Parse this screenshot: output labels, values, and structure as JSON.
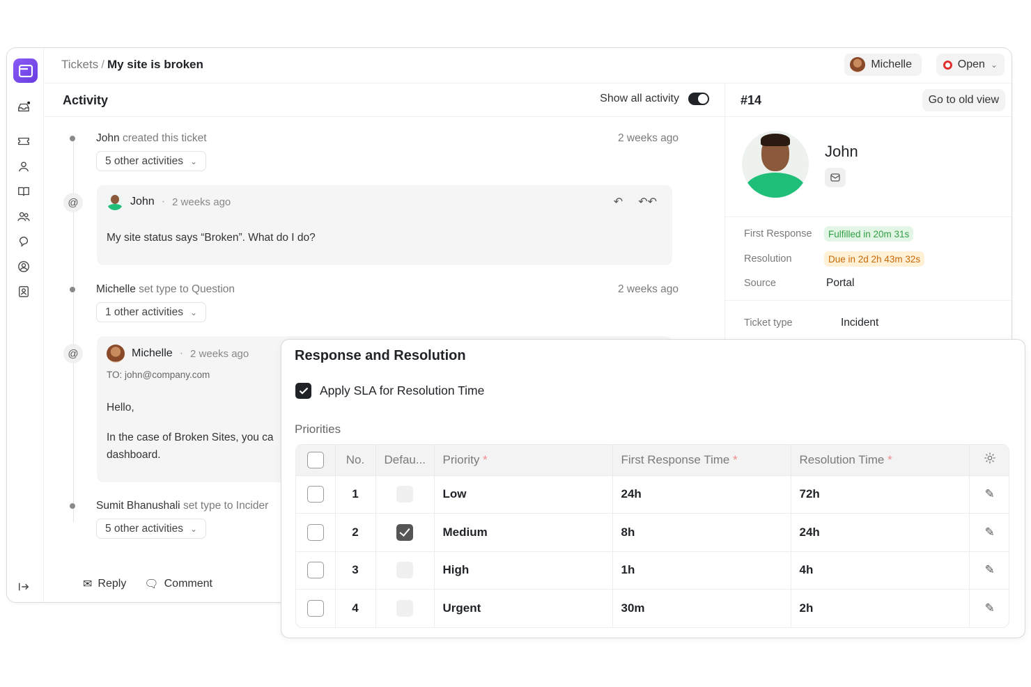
{
  "breadcrumb": {
    "root": "Tickets",
    "separator": "/",
    "current": "My site is broken"
  },
  "header": {
    "user": "Michelle",
    "status": "Open"
  },
  "activity": {
    "title": "Activity",
    "toggle_label": "Show all activity",
    "events": [
      {
        "actor": "John",
        "text": "created this ticket",
        "time": "2 weeks ago",
        "more": "5 other activities"
      },
      {
        "actor": "Michelle",
        "text": "set type to Question",
        "time": "2 weeks ago",
        "more": "1 other activities"
      },
      {
        "actor": "Sumit Bhanushali",
        "text": "set type to Incider",
        "more": "5 other activities"
      }
    ],
    "messages": [
      {
        "author": "John",
        "time": "2 weeks ago",
        "body": "My site status says “Broken”. What do I do?"
      },
      {
        "author": "Michelle",
        "time": "2 weeks ago",
        "to_label": "TO:",
        "to": "john@company.com",
        "greeting": "Hello,",
        "body_line1": "In the case of Broken Sites, you ca",
        "body_line2": "dashboard."
      }
    ],
    "footer": {
      "reply": "Reply",
      "comment": "Comment"
    }
  },
  "side": {
    "ticket_no": "#14",
    "old_view": "Go to old view",
    "contact_name": "John",
    "first_response_label": "First Response",
    "first_response_value": "Fulfilled in 20m 31s",
    "resolution_label": "Resolution",
    "resolution_value": "Due in 2d 2h 43m 32s",
    "source_label": "Source",
    "source_value": "Portal",
    "ticket_type_label": "Ticket type",
    "ticket_type_value": "Incident"
  },
  "sla": {
    "title": "Response and Resolution",
    "apply_label": "Apply SLA for Resolution Time",
    "priorities_label": "Priorities",
    "columns": {
      "no": "No.",
      "default": "Defau...",
      "priority": "Priority",
      "first_response": "First Response Time",
      "resolution": "Resolution Time",
      "required_mark": "*"
    },
    "rows": [
      {
        "no": "1",
        "priority": "Low",
        "first_response": "24h",
        "resolution": "72h",
        "default": false
      },
      {
        "no": "2",
        "priority": "Medium",
        "first_response": "8h",
        "resolution": "24h",
        "default": true
      },
      {
        "no": "3",
        "priority": "High",
        "first_response": "1h",
        "resolution": "4h",
        "default": false
      },
      {
        "no": "4",
        "priority": "Urgent",
        "first_response": "30m",
        "resolution": "2h",
        "default": false
      }
    ]
  },
  "colors": {
    "accent": "#7c4dff",
    "status_open": "#e03131",
    "fulfilled": "#2f9e44",
    "due": "#c76a05"
  }
}
